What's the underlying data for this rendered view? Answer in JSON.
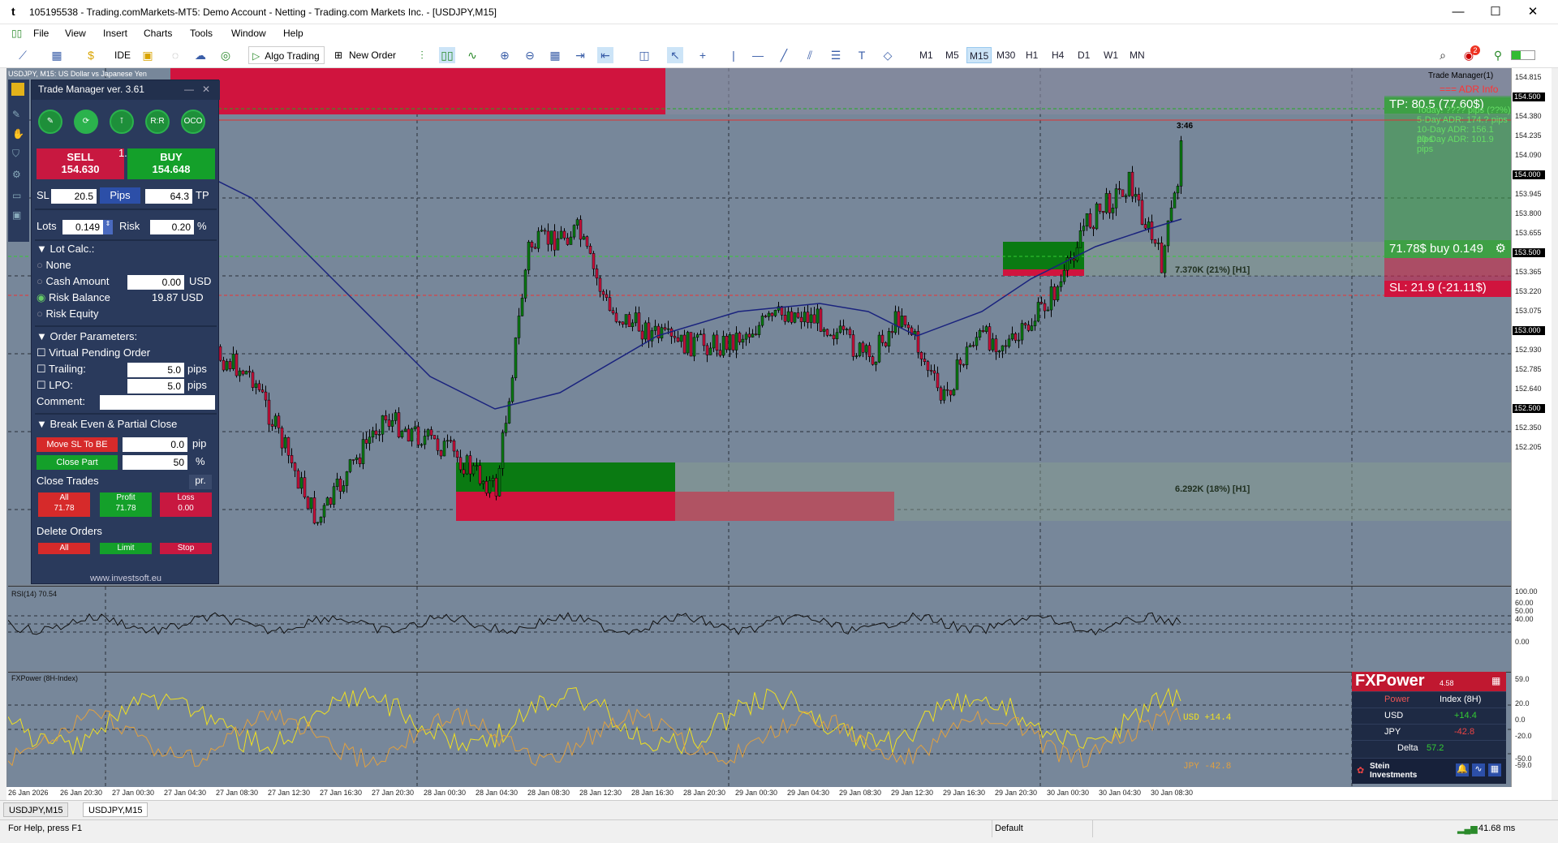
{
  "window": {
    "title": "105195538 - Trading.comMarkets-MT5: Demo Account - Netting - Trading.com Markets Inc. - [USDJPY,M15]",
    "minimize": "—",
    "maximize": "☐",
    "close": "✕"
  },
  "menu": [
    "File",
    "View",
    "Insert",
    "Charts",
    "Tools",
    "Window",
    "Help"
  ],
  "toolbar": {
    "ide": "IDE",
    "algo_trading": "Algo Trading",
    "new_order": "New Order",
    "timeframes": [
      "M1",
      "M5",
      "M15",
      "M30",
      "H1",
      "H4",
      "D1",
      "W1",
      "MN"
    ],
    "active_timeframe": "M15",
    "notifications_count": "2"
  },
  "chart": {
    "symbol_label": "USDJPY, M15:  US Dollar vs Japanese Yen",
    "price_labels": [
      "154.815",
      "154.500",
      "154.380",
      "154.235",
      "154.090",
      "154.000",
      "153.945",
      "153.800",
      "153.655",
      "153.500",
      "153.365",
      "153.220",
      "153.075",
      "153.000",
      "152.930",
      "152.785",
      "152.640",
      "152.500",
      "152.350",
      "152.205"
    ],
    "box_label_upper": "7.370K (21%) [H1]",
    "box_label_lower": "6.292K (18%) [H1]",
    "timer": "3:46",
    "trade_manager_tag": "Trade Manager(1)",
    "adr_title": "=== ADR Info ===",
    "adr_lines": [
      "Today: ???? pips (??%)",
      "5-Day ADR: 174.? pips",
      "10-Day ADR: 156.1 pips",
      "20-Day ADR: 101.9 pips"
    ],
    "tp_label": "TP: 80.5 (77.60$)",
    "position_label": "71.78$ buy 0.149",
    "sl_label": "SL: 21.9 (-21.11$)",
    "colors": {
      "bg": "#77879a",
      "sell_zone": "#d0143e",
      "buy_zone": "#0a7a12",
      "ma": "#1a237e"
    }
  },
  "rsi": {
    "label": "RSI(14) 70.54",
    "levels": [
      "100.00",
      "60.00",
      "50.00",
      "40.00",
      "0.00"
    ]
  },
  "fxpower_chart": {
    "label": "FXPower (8H-Index)",
    "usd_label": "USD +14.4",
    "jpy_label": "JPY -42.8",
    "levels": [
      "59.0",
      "20.0",
      "0.0",
      "-20.0",
      "-50.0",
      "-59.0"
    ]
  },
  "time_labels": [
    "26 Jan 2026",
    "26 Jan 20:30",
    "27 Jan 00:30",
    "27 Jan 04:30",
    "27 Jan 08:30",
    "27 Jan 12:30",
    "27 Jan 16:30",
    "27 Jan 20:30",
    "28 Jan 00:30",
    "28 Jan 04:30",
    "28 Jan 08:30",
    "28 Jan 12:30",
    "28 Jan 16:30",
    "28 Jan 20:30",
    "29 Jan 00:30",
    "29 Jan 04:30",
    "29 Jan 08:30",
    "29 Jan 12:30",
    "29 Jan 16:30",
    "29 Jan 20:30",
    "30 Jan 00:30",
    "30 Jan 04:30",
    "30 Jan 08:30"
  ],
  "trade_manager": {
    "title": "Trade Manager ver. 3.61",
    "icons": [
      "R:R",
      "OCO"
    ],
    "sell_label": "SELL",
    "sell_price": "154.630",
    "buy_label": "BUY",
    "buy_price": "154.648",
    "spread": "1.8",
    "sl_label": "SL",
    "sl_value": "20.5",
    "pips_label": "Pips",
    "tp_value": "64.3",
    "tp_label": "TP",
    "lots_label": "Lots",
    "lots_value": "0.149",
    "risk_label": "Risk",
    "risk_value": "0.20",
    "pct": "%",
    "lot_calc": "Lot Calc.:",
    "opt_none": "None",
    "opt_cash": "Cash Amount",
    "cash_value": "0.00",
    "usd": "USD",
    "opt_risk_balance": "Risk Balance",
    "risk_balance_value": "19.87 USD",
    "opt_risk_equity": "Risk Equity",
    "order_params": "Order Parameters:",
    "virtual_pending": "Virtual Pending Order",
    "trailing": "Trailing:",
    "trailing_value": "5.0",
    "lpo": "LPO:",
    "lpo_value": "5.0",
    "pips": "pips",
    "comment": "Comment:",
    "be_partial": "Break Even & Partial Close",
    "move_sl": "Move SL To BE",
    "move_sl_value": "0.0",
    "pip": "pip",
    "close_part": "Close Part",
    "close_part_value": "50",
    "close_trades": "Close Trades",
    "pr": "pr.",
    "all": "All",
    "all_value": "71.78",
    "profit": "Profit",
    "profit_value": "71.78",
    "loss": "Loss",
    "loss_value": "0.00",
    "delete_orders": "Delete Orders",
    "del_all": "All",
    "del_limit": "Limit",
    "del_stop": "Stop",
    "website": "www.investsoft.eu"
  },
  "fxpower_panel": {
    "title": "FXPower",
    "version": "4.58",
    "col_power": "Power",
    "col_index": "Index (8H)",
    "usd": "USD",
    "usd_value": "+14.4",
    "jpy": "JPY",
    "jpy_value": "-42.8",
    "delta_label": "Delta",
    "delta_value": "57.2",
    "brand": "Stein Investments"
  },
  "tabs": [
    "USDJPY,M15",
    "USDJPY,M15"
  ],
  "status": {
    "help": "For Help, press F1",
    "profile": "Default",
    "ping": "41.68 ms"
  }
}
